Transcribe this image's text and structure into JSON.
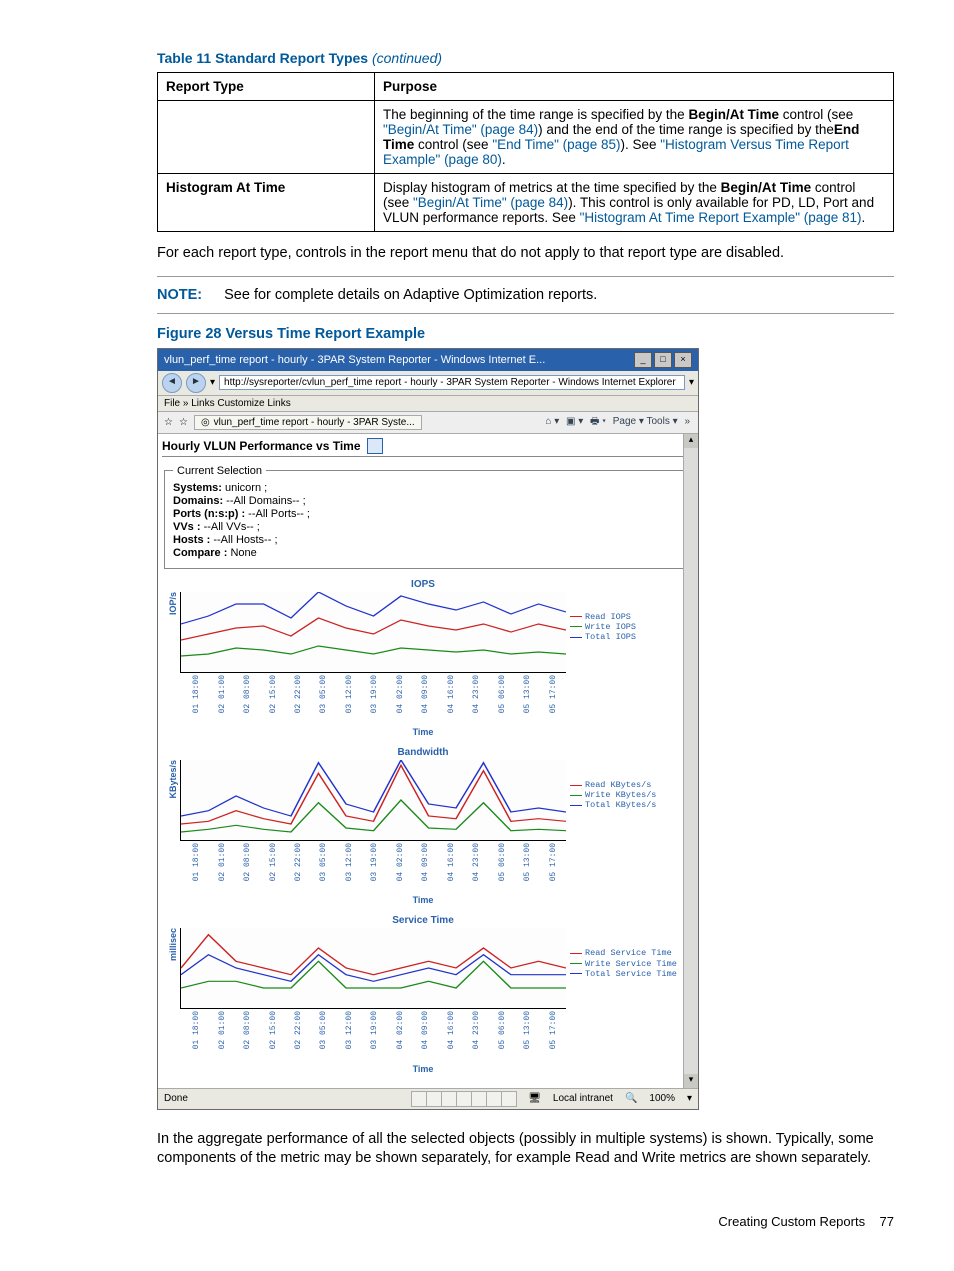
{
  "tableCaption": "Table 11 Standard Report Types",
  "tableCaptionCont": "(continued)",
  "headers": {
    "col1": "Report Type",
    "col2": "Purpose"
  },
  "row1": {
    "type": "",
    "purpose_a": "The beginning of the time range is specified by the ",
    "purpose_b": "Begin/At Time",
    "purpose_c": " control (see ",
    "purpose_d": "\"Begin/At Time\" (page 84)",
    "purpose_e": ") and the end of the time range is specified by the",
    "purpose_f": "End Time",
    "purpose_g": " control (see ",
    "purpose_h": "\"End Time\" (page 85)",
    "purpose_i": "). See ",
    "purpose_j": "\"Histogram Versus Time Report Example\" (page 80)",
    "purpose_k": "."
  },
  "row2": {
    "type": "Histogram At Time",
    "purpose_a": "Display histogram of metrics at the time specified by the ",
    "purpose_b": "Begin/At Time",
    "purpose_c": " control (see ",
    "purpose_d": "\"Begin/At Time\" (page 84)",
    "purpose_e": "). This control is only available for PD, LD, Port and VLUN performance reports. See ",
    "purpose_f": "\"Histogram At Time Report Example\" (page 81)",
    "purpose_g": "."
  },
  "para1": "For each report type, controls in the report menu that do not apply to that report type are disabled.",
  "noteLabel": "NOTE:",
  "noteText": "See for complete details on Adaptive Optimization reports.",
  "figureTitle": "Figure 28 Versus Time Report Example",
  "browser": {
    "title": "vlun_perf_time report - hourly - 3PAR System Reporter - Windows Internet E...",
    "url": "http://sysreporter/cvlun_perf_time report - hourly - 3PAR System Reporter - Windows Internet Explorer",
    "menu": "File   »  Links   Customize Links",
    "tabLabel": "vlun_perf_time report - hourly - 3PAR Syste...",
    "toolsText": "Page ▾      Tools ▾",
    "reportTitle": "Hourly VLUN Performance vs Time",
    "selLegend": "Current Selection",
    "sel": {
      "systems_k": "Systems:",
      "systems_v": " unicorn ;",
      "domains_k": "Domains:",
      "domains_v": " --All Domains-- ;",
      "ports_k": "Ports (n:s:p) :",
      "ports_v": " --All Ports-- ;",
      "vvs_k": "VVs :",
      "vvs_v": " --All VVs-- ;",
      "hosts_k": "Hosts :",
      "hosts_v": " --All Hosts-- ;",
      "compare_k": "Compare :",
      "compare_v": " None"
    },
    "statusLeft": "Done",
    "statusZone": "Local intranet",
    "statusZoom": "100%"
  },
  "para2": "In the aggregate performance of all the selected objects (possibly in multiple systems) is shown. Typically, some components of the metric may be shown separately, for example Read and Write metrics are shown separately.",
  "footerLabel": "Creating Custom Reports",
  "footerPage": "77",
  "chart_data": [
    {
      "type": "line",
      "title": "IOPS",
      "ylabel": "IOP/s",
      "xlabel": "Time",
      "x": [
        "01 18:00",
        "02 01:00",
        "02 08:00",
        "02 15:00",
        "02 22:00",
        "03 05:00",
        "03 12:00",
        "03 19:00",
        "04 02:00",
        "04 09:00",
        "04 16:00",
        "04 23:00",
        "05 06:00",
        "05 13:00",
        "05 17:00"
      ],
      "ylim": [
        0,
        4000
      ],
      "series": [
        {
          "name": "Read IOPS",
          "color": "#c22",
          "values": [
            1600,
            1900,
            2200,
            2300,
            1800,
            2700,
            2200,
            1900,
            2600,
            2300,
            2100,
            2400,
            2000,
            2400,
            2100
          ]
        },
        {
          "name": "Write IOPS",
          "color": "#1a8a1a",
          "values": [
            800,
            900,
            1200,
            1100,
            900,
            1300,
            1100,
            900,
            1200,
            1100,
            1000,
            1100,
            900,
            1000,
            900
          ]
        },
        {
          "name": "Total IOPS",
          "color": "#2233cc",
          "values": [
            2400,
            2800,
            3400,
            3400,
            2700,
            4000,
            3300,
            2800,
            3800,
            3400,
            3100,
            3500,
            2900,
            3400,
            3000
          ]
        }
      ]
    },
    {
      "type": "line",
      "title": "Bandwidth",
      "ylabel": "KBytes/s",
      "xlabel": "Time",
      "x": [
        "01 18:00",
        "02 01:00",
        "02 08:00",
        "02 15:00",
        "02 22:00",
        "03 05:00",
        "03 12:00",
        "03 19:00",
        "04 02:00",
        "04 09:00",
        "04 16:00",
        "04 23:00",
        "05 06:00",
        "05 13:00",
        "05 17:00"
      ],
      "ylim": [
        0,
        300000
      ],
      "series": [
        {
          "name": "Read KBytes/s",
          "color": "#c22",
          "values": [
            60000,
            70000,
            110000,
            80000,
            60000,
            250000,
            90000,
            70000,
            280000,
            90000,
            80000,
            260000,
            70000,
            80000,
            70000
          ]
        },
        {
          "name": "Write KBytes/s",
          "color": "#1a8a1a",
          "values": [
            30000,
            40000,
            55000,
            40000,
            30000,
            140000,
            45000,
            35000,
            150000,
            45000,
            40000,
            140000,
            35000,
            40000,
            35000
          ]
        },
        {
          "name": "Total KBytes/s",
          "color": "#2233cc",
          "values": [
            90000,
            110000,
            165000,
            120000,
            90000,
            290000,
            135000,
            105000,
            300000,
            135000,
            120000,
            290000,
            105000,
            120000,
            105000
          ]
        }
      ]
    },
    {
      "type": "line",
      "title": "Service Time",
      "ylabel": "millisec",
      "xlabel": "Time",
      "x": [
        "01 18:00",
        "02 01:00",
        "02 08:00",
        "02 15:00",
        "02 22:00",
        "03 05:00",
        "03 12:00",
        "03 19:00",
        "04 02:00",
        "04 09:00",
        "04 16:00",
        "04 23:00",
        "05 06:00",
        "05 13:00",
        "05 17:00"
      ],
      "ylim": [
        0,
        12
      ],
      "series": [
        {
          "name": "Read Service Time",
          "color": "#c22",
          "values": [
            6,
            11,
            7,
            6,
            5,
            9,
            6,
            5,
            6,
            7,
            6,
            9,
            6,
            7,
            6
          ]
        },
        {
          "name": "Write Service Time",
          "color": "#1a8a1a",
          "values": [
            3,
            4,
            4,
            3,
            3,
            7,
            3,
            3,
            3,
            4,
            3,
            7,
            3,
            3,
            3
          ]
        },
        {
          "name": "Total Service Time",
          "color": "#2233cc",
          "values": [
            5,
            8,
            6,
            5,
            4,
            8,
            5,
            4,
            5,
            6,
            5,
            8,
            5,
            5,
            5
          ]
        }
      ]
    }
  ]
}
